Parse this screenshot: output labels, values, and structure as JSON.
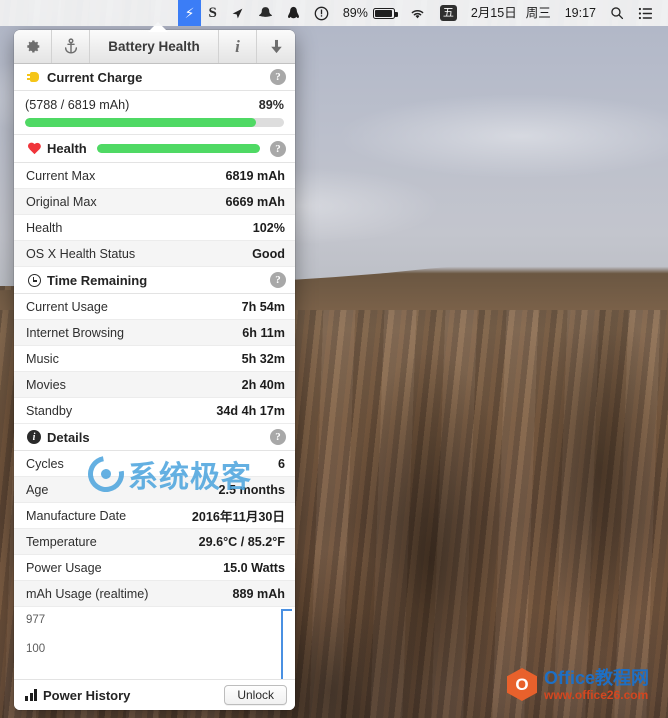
{
  "menubar": {
    "items": [
      {
        "name": "lightning-icon",
        "glyph": "⚡",
        "kind": "icon",
        "active": true
      },
      {
        "name": "shadowsocks-icon",
        "glyph": "S",
        "kind": "letter",
        "active": false
      },
      {
        "name": "location-arrow-icon",
        "glyph": "➤",
        "kind": "icon",
        "active": false
      },
      {
        "name": "snapchat-ghost-icon",
        "glyph": "◓",
        "kind": "icon",
        "active": false
      },
      {
        "name": "qq-penguin-icon",
        "glyph": "●",
        "kind": "icon",
        "active": false
      },
      {
        "name": "do-not-disturb-icon",
        "glyph": "①",
        "kind": "icon",
        "active": false
      }
    ],
    "battery_percent": "89%",
    "wifi_icon": "wifi-icon",
    "input_source": "五",
    "date": "2月15日",
    "weekday": "周三",
    "time": "19:17",
    "search_icon": "search-icon",
    "notification_icon": "notification-center-icon"
  },
  "panel": {
    "toolbar": {
      "gear_icon": "gear-icon",
      "anchor_icon": "anchor-icon",
      "title": "Battery Health",
      "info_icon": "info-icon",
      "download_icon": "download-arrow-icon"
    },
    "current_charge": {
      "header": "Current Charge",
      "plug_icon": "plug-icon",
      "help_label": "?",
      "detail": "(5788 / 6819 mAh)",
      "percent_label": "89%",
      "percent_value": 89,
      "bar_color": "#4fd964",
      "track_color": "#dddddd"
    },
    "health": {
      "header": "Health",
      "heart_icon": "heart-icon",
      "help_label": "?",
      "bar_percent": 100,
      "bar_color": "#4fd964",
      "rows": [
        {
          "key": "Current Max",
          "value": "6819 mAh"
        },
        {
          "key": "Original Max",
          "value": "6669 mAh"
        },
        {
          "key": "Health",
          "value": "102%"
        },
        {
          "key": "OS X Health Status",
          "value": "Good"
        }
      ]
    },
    "time_remaining": {
      "header": "Time Remaining",
      "clock_icon": "clock-icon",
      "help_label": "?",
      "rows": [
        {
          "key": "Current Usage",
          "value": "7h 54m"
        },
        {
          "key": "Internet Browsing",
          "value": "6h 11m"
        },
        {
          "key": "Music",
          "value": "5h 32m"
        },
        {
          "key": "Movies",
          "value": "2h 40m"
        },
        {
          "key": "Standby",
          "value": "34d 4h 17m"
        }
      ]
    },
    "details": {
      "header": "Details",
      "info_icon": "info-circle-icon",
      "help_label": "?",
      "rows": [
        {
          "key": "Cycles",
          "value": "6"
        },
        {
          "key": "Age",
          "value": "2.5 months"
        },
        {
          "key": "Manufacture Date",
          "value": "2016年11月30日"
        },
        {
          "key": "Temperature",
          "value": "29.6°C / 85.2°F"
        },
        {
          "key": "Power Usage",
          "value": "15.0 Watts"
        },
        {
          "key": "mAh Usage (realtime)",
          "value": "889 mAh"
        }
      ]
    },
    "graph": {
      "top_label": "977",
      "bottom_label": "100",
      "line_color": "#4a90e2"
    },
    "footer": {
      "bars_icon": "bar-chart-icon",
      "title": "Power History",
      "unlock_button": "Unlock"
    }
  },
  "watermarks": {
    "cn_text": "系统极客",
    "cn_color": "#4aa3dd",
    "office_title": "Office教程网",
    "office_url": "www.office26.com",
    "office_mark": "O",
    "office_accent": "#e8612c"
  }
}
